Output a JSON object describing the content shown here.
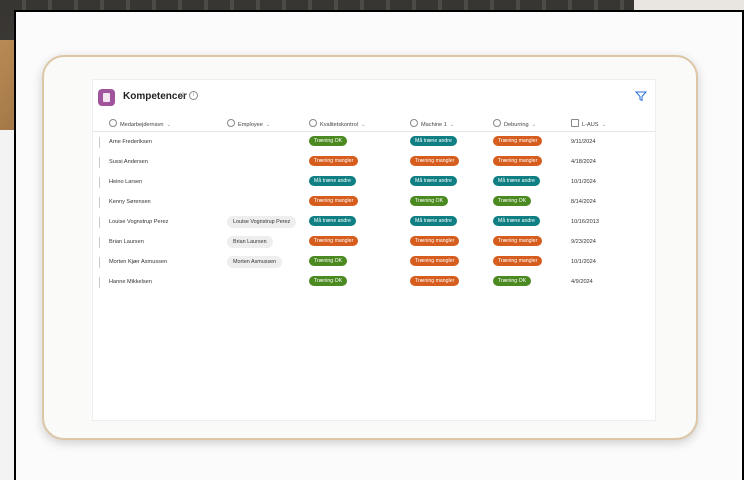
{
  "colors": {
    "green": "#4b8a20",
    "orange": "#d65d1e",
    "teal": "#0f7f84",
    "app_icon": "#a0549b"
  },
  "status_classes": {
    "Træning OK": "green",
    "Træning mangler": "orange",
    "Må træne andre": "teal"
  },
  "list": {
    "title": "Kompetencer",
    "favorite_icon": "☆",
    "info_icon": "i"
  },
  "columns": [
    {
      "label": "Medarbejdernavn",
      "icon": "text-column-icon"
    },
    {
      "label": "Employee",
      "icon": "person-column-icon"
    },
    {
      "label": "Kvalitetskontrol",
      "icon": "choice-column-icon"
    },
    {
      "label": "Machine 1",
      "icon": "choice-column-icon"
    },
    {
      "label": "Deburring",
      "icon": "choice-column-icon"
    },
    {
      "label": "L-AUS",
      "icon": "calendar-column-icon"
    }
  ],
  "rows": [
    {
      "name": "Arne Frederiksen",
      "employee": "",
      "kvalitetskontrol": "Træning OK",
      "machine1": "Må træne andre",
      "deburring": "Træning mangler",
      "laus": "9/11/2024"
    },
    {
      "name": "Sussi Andersen",
      "employee": "",
      "kvalitetskontrol": "Træning mangler",
      "machine1": "Træning mangler",
      "deburring": "Træning mangler",
      "laus": "4/18/2024"
    },
    {
      "name": "Heino Larsen",
      "employee": "",
      "kvalitetskontrol": "Må træne andre",
      "machine1": "Må træne andre",
      "deburring": "Må træne andre",
      "laus": "10/1/2024"
    },
    {
      "name": "Kenny Sørensen",
      "employee": "",
      "kvalitetskontrol": "Træning mangler",
      "machine1": "Træning OK",
      "deburring": "Træning OK",
      "laus": "8/14/2024"
    },
    {
      "name": "Louise Vognstrup Perez",
      "employee": "Louise Vognstrup Perez",
      "kvalitetskontrol": "Må træne andre",
      "machine1": "Må træne andre",
      "deburring": "Må træne andre",
      "laus": "10/16/2013"
    },
    {
      "name": "Brian Laursen",
      "employee": "Brian Laursen",
      "kvalitetskontrol": "Træning mangler",
      "machine1": "Træning mangler",
      "deburring": "Træning mangler",
      "laus": "9/23/2024"
    },
    {
      "name": "Morten Kjær Asmussen",
      "employee": "Morten Asmussen",
      "kvalitetskontrol": "Træning OK",
      "machine1": "Træning mangler",
      "deburring": "Træning mangler",
      "laus": "10/1/2024"
    },
    {
      "name": "Hanne Mikkelsen",
      "employee": "",
      "kvalitetskontrol": "Træning OK",
      "machine1": "Træning mangler",
      "deburring": "Træning OK",
      "laus": "4/9/2024"
    }
  ]
}
